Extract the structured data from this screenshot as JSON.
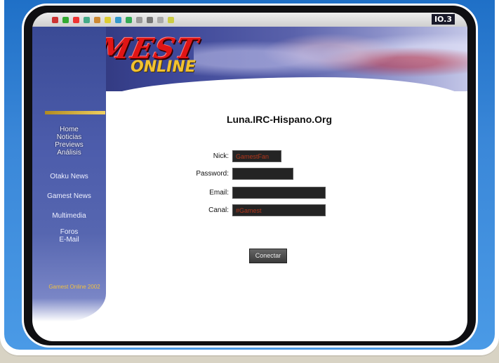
{
  "toolbar": {
    "brand": "IO.3"
  },
  "site": {
    "logo_main": "GAMEST",
    "logo_sub": "ONLINE"
  },
  "sidebar": {
    "items": [
      {
        "label": "Home"
      },
      {
        "label": "Noticias"
      },
      {
        "label": "Previews"
      },
      {
        "label": "Análisis"
      },
      {
        "label": "Otaku News"
      },
      {
        "label": "Gamest News"
      },
      {
        "label": "Multimedia"
      },
      {
        "label": "Foros"
      },
      {
        "label": "E-Mail"
      }
    ],
    "footer": "Gamest Online 2002"
  },
  "chat": {
    "server": "Luna.IRC-Hispano.Org",
    "fields": [
      {
        "label": "Nick:",
        "value": "GamestFan"
      },
      {
        "label": "Password:",
        "value": ""
      },
      {
        "label": "Email:",
        "value": ""
      },
      {
        "label": "Canal:",
        "value": "#Gamest"
      }
    ],
    "connect_label": "Conectar"
  }
}
